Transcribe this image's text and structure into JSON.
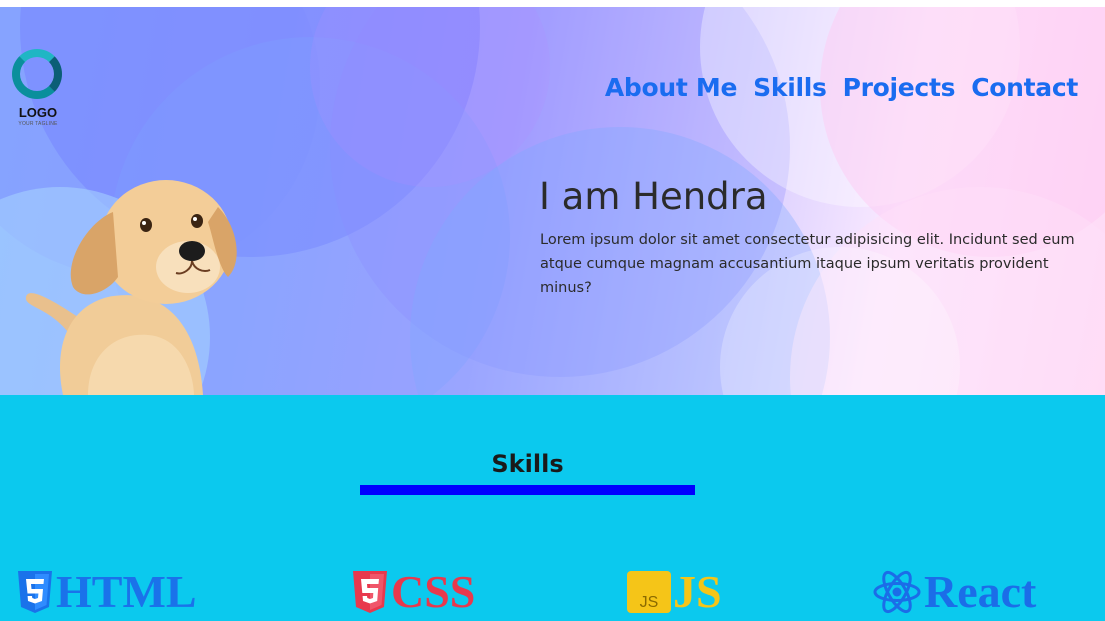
{
  "logo": {
    "text": "LOGO",
    "tagline": "YOUR TAGLINE"
  },
  "nav": {
    "items": [
      {
        "label": "About Me"
      },
      {
        "label": "Skills"
      },
      {
        "label": "Projects"
      },
      {
        "label": "Contact"
      }
    ],
    "color": "#1a6cf0"
  },
  "hero": {
    "title": "I am Hendra",
    "text": "Lorem ipsum dolor sit amet consectetur adipisicing elit. Incidunt sed eum atque cumque magnam accusantium itaque ipsum veritatis provident minus?"
  },
  "skills": {
    "title": "Skills",
    "accent": "#0000ff",
    "background": "#0bc9ee",
    "items": [
      {
        "label": "HTML",
        "icon": "html5-icon",
        "color": "#1a72ea"
      },
      {
        "label": "CSS",
        "icon": "css3-icon",
        "color": "#e8394d"
      },
      {
        "label": "JS",
        "icon": "javascript-icon",
        "color": "#f5c518"
      },
      {
        "label": "React",
        "icon": "react-icon",
        "color": "#1b6de8"
      }
    ]
  }
}
